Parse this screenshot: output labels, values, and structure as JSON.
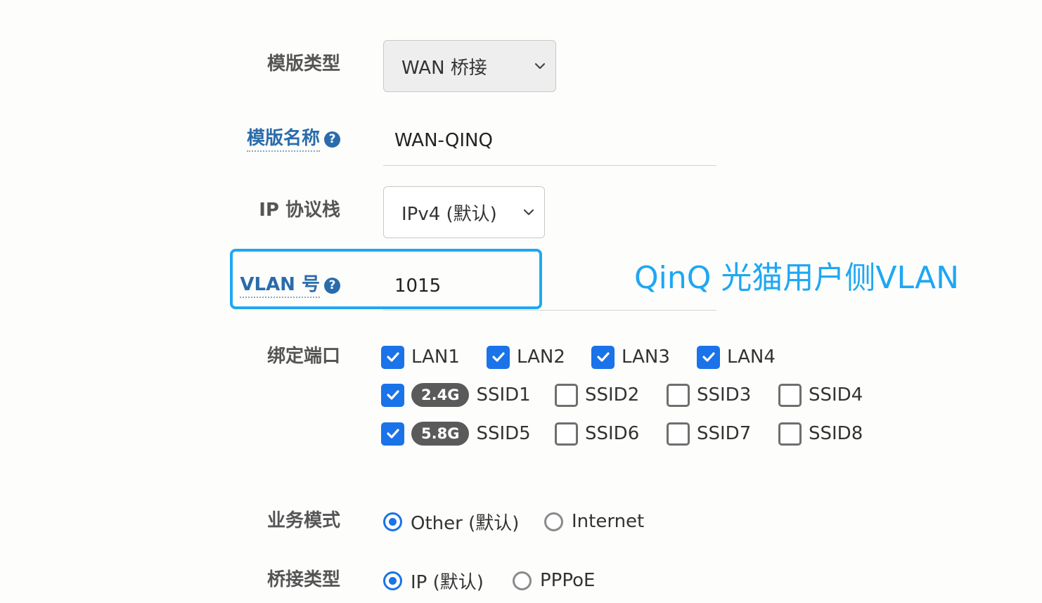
{
  "form": {
    "template_type": {
      "label": "模版类型",
      "value": "WAN 桥接"
    },
    "template_name": {
      "label": "模版名称",
      "help_icon": "question-circle-icon",
      "value": "WAN-QINQ"
    },
    "ip_stack": {
      "label": "IP 协议栈",
      "value": "IPv4 (默认)"
    },
    "vlan": {
      "label": "VLAN 号",
      "help_icon": "question-circle-icon",
      "value": "1015"
    },
    "bind_ports": {
      "label": "绑定端口",
      "lan": [
        {
          "label": "LAN1",
          "checked": true
        },
        {
          "label": "LAN2",
          "checked": true
        },
        {
          "label": "LAN3",
          "checked": true
        },
        {
          "label": "LAN4",
          "checked": true
        }
      ],
      "ssid_24": {
        "band": "2.4G",
        "items": [
          {
            "label": "SSID1",
            "checked": true
          },
          {
            "label": "SSID2",
            "checked": false
          },
          {
            "label": "SSID3",
            "checked": false
          },
          {
            "label": "SSID4",
            "checked": false
          }
        ]
      },
      "ssid_58": {
        "band": "5.8G",
        "items": [
          {
            "label": "SSID5",
            "checked": true
          },
          {
            "label": "SSID6",
            "checked": false
          },
          {
            "label": "SSID7",
            "checked": false
          },
          {
            "label": "SSID8",
            "checked": false
          }
        ]
      }
    },
    "service_mode": {
      "label": "业务模式",
      "options": [
        {
          "label": "Other (默认)",
          "selected": true
        },
        {
          "label": "Internet",
          "selected": false
        }
      ]
    },
    "bridge_type": {
      "label": "桥接类型",
      "options": [
        {
          "label": "IP (默认)",
          "selected": true
        },
        {
          "label": "PPPoE",
          "selected": false
        }
      ]
    }
  },
  "annotation": {
    "text": "QinQ 光猫用户侧VLAN",
    "color": "#1ea7f4"
  },
  "colors": {
    "accent": "#1a73e8",
    "help_label": "#2a6cab",
    "badge": "#5a5a5a"
  }
}
